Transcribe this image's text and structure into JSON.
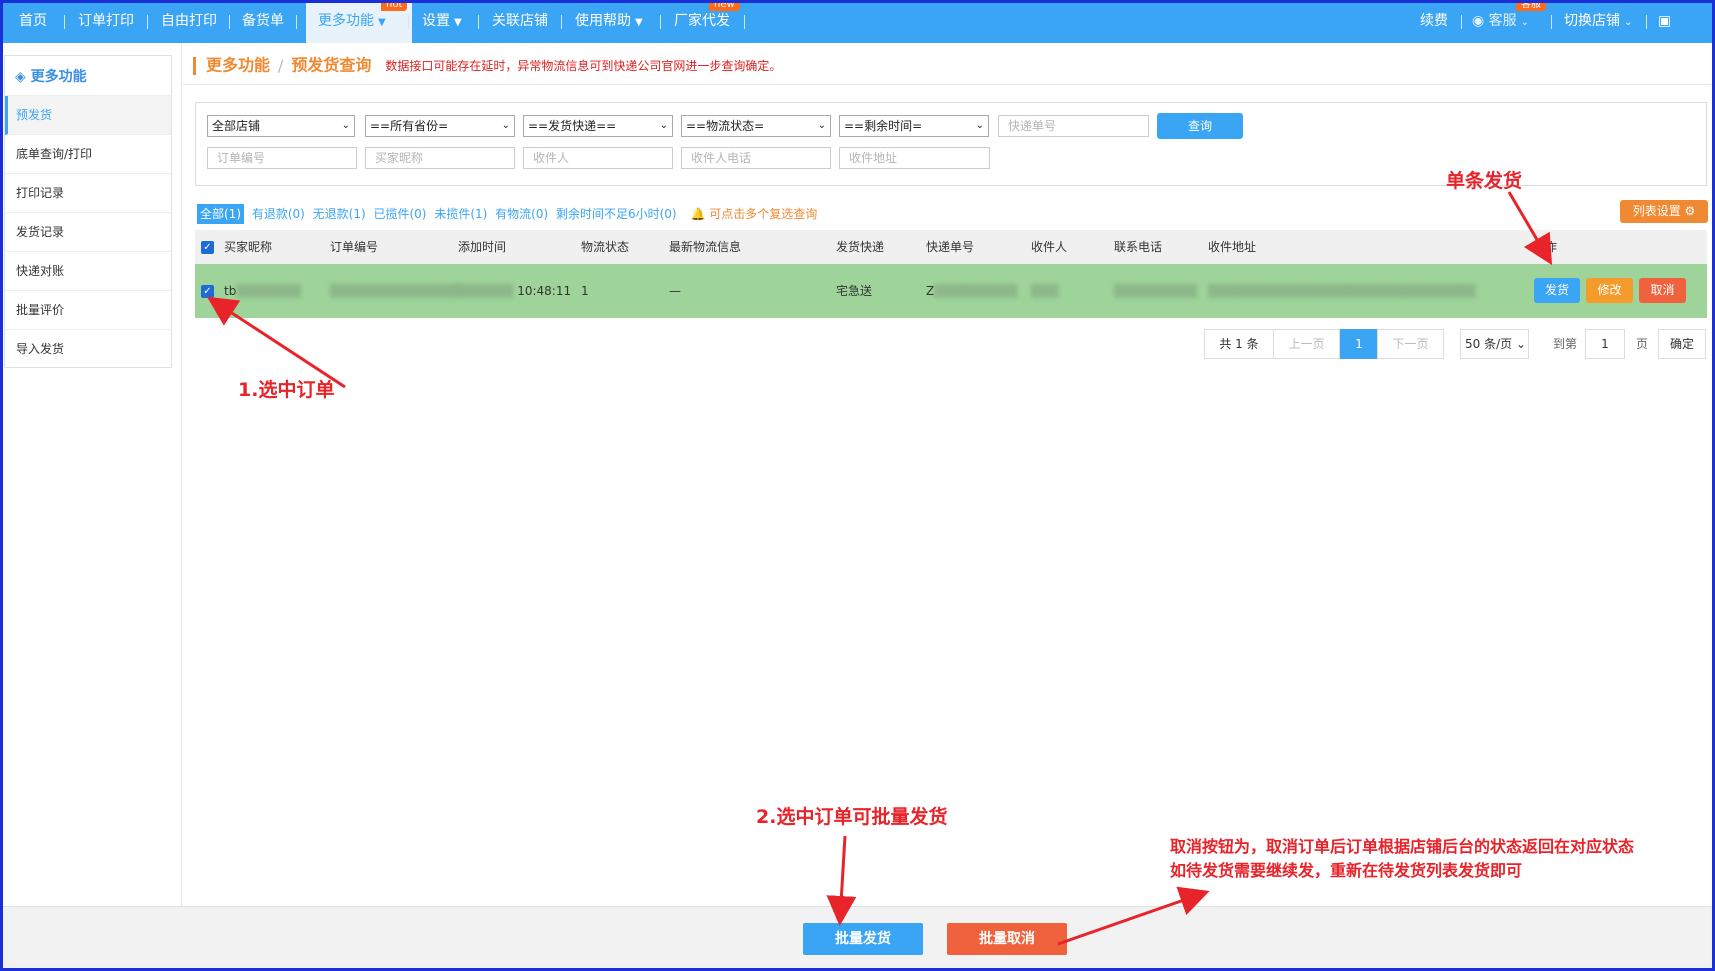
{
  "nav": {
    "items": [
      "首页",
      "订单打印",
      "自由打印",
      "备货单",
      "更多功能",
      "设置",
      "关联店铺",
      "使用帮助",
      "厂家代发"
    ],
    "hot_badge": "hot",
    "new_badge": "new",
    "right": [
      "续费",
      "客服",
      "切换店铺"
    ],
    "kefu_badge": "客服"
  },
  "sidebar": {
    "title": "更多功能",
    "items": [
      "预发货",
      "底单查询/打印",
      "打印记录",
      "发货记录",
      "快递对账",
      "批量评价",
      "导入发货"
    ]
  },
  "breadcrumb": {
    "section": "更多功能",
    "page": "预发货查询",
    "note": "数据接口可能存在延时，异常物流信息可到快递公司官网进一步查询确定。"
  },
  "filters": {
    "shop": "全部店铺",
    "province": "==所有省份=",
    "express": "==发货快递==",
    "logistics_status": "==物流状态=",
    "remaining_time": "==剩余时间=",
    "tracking_placeholder": "快递单号",
    "order_no_placeholder": "订单编号",
    "buyer_placeholder": "买家昵称",
    "receiver_placeholder": "收件人",
    "receiver_phone_placeholder": "收件人电话",
    "receiver_addr_placeholder": "收件地址",
    "query_button": "查询"
  },
  "tabs": [
    "全部(1)",
    "有退款(0)",
    "无退款(1)",
    "已揽件(0)",
    "未揽件(1)",
    "有物流(0)",
    "剩余时间不足6小时(0)"
  ],
  "tabs_tip": "可点击多个复选查询",
  "list_settings": "列表设置",
  "table": {
    "columns": [
      "买家昵称",
      "订单编号",
      "添加时间",
      "物流状态",
      "最新物流信息",
      "发货快递",
      "快递单号",
      "收件人",
      "联系电话",
      "收件地址",
      "操作"
    ],
    "row": {
      "buyer": "tb",
      "order_no": "",
      "time": "10:48:11",
      "status": "1",
      "latest": "—",
      "express": "宅急送",
      "tracking": "Z",
      "receiver": "",
      "phone": "",
      "address": ""
    },
    "actions": [
      "发货",
      "修改",
      "取消"
    ]
  },
  "pagination": {
    "total": "共 1 条",
    "prev": "上一页",
    "current": "1",
    "next": "下一页",
    "per_page": "50 条/页",
    "goto_label": "到第",
    "goto_value": "1",
    "page_label": "页",
    "confirm": "确定"
  },
  "footer": {
    "batch_ship": "批量发货",
    "batch_cancel": "批量取消"
  },
  "annotations": {
    "single_ship": "单条发货",
    "select_order": "1.选中订单",
    "batch_tip": "2.选中订单可批量发货",
    "cancel_tip_1": "取消按钮为，取消订单后订单根据店铺后台的状态返回在对应状态",
    "cancel_tip_2": "如待发货需要继续发，重新在待发货列表发货即可"
  },
  "colors": {
    "nav_blue": "#3aa5f5",
    "orange": "#f08a32",
    "row_green": "#9ed49a",
    "annotation_red": "#e8232a"
  }
}
